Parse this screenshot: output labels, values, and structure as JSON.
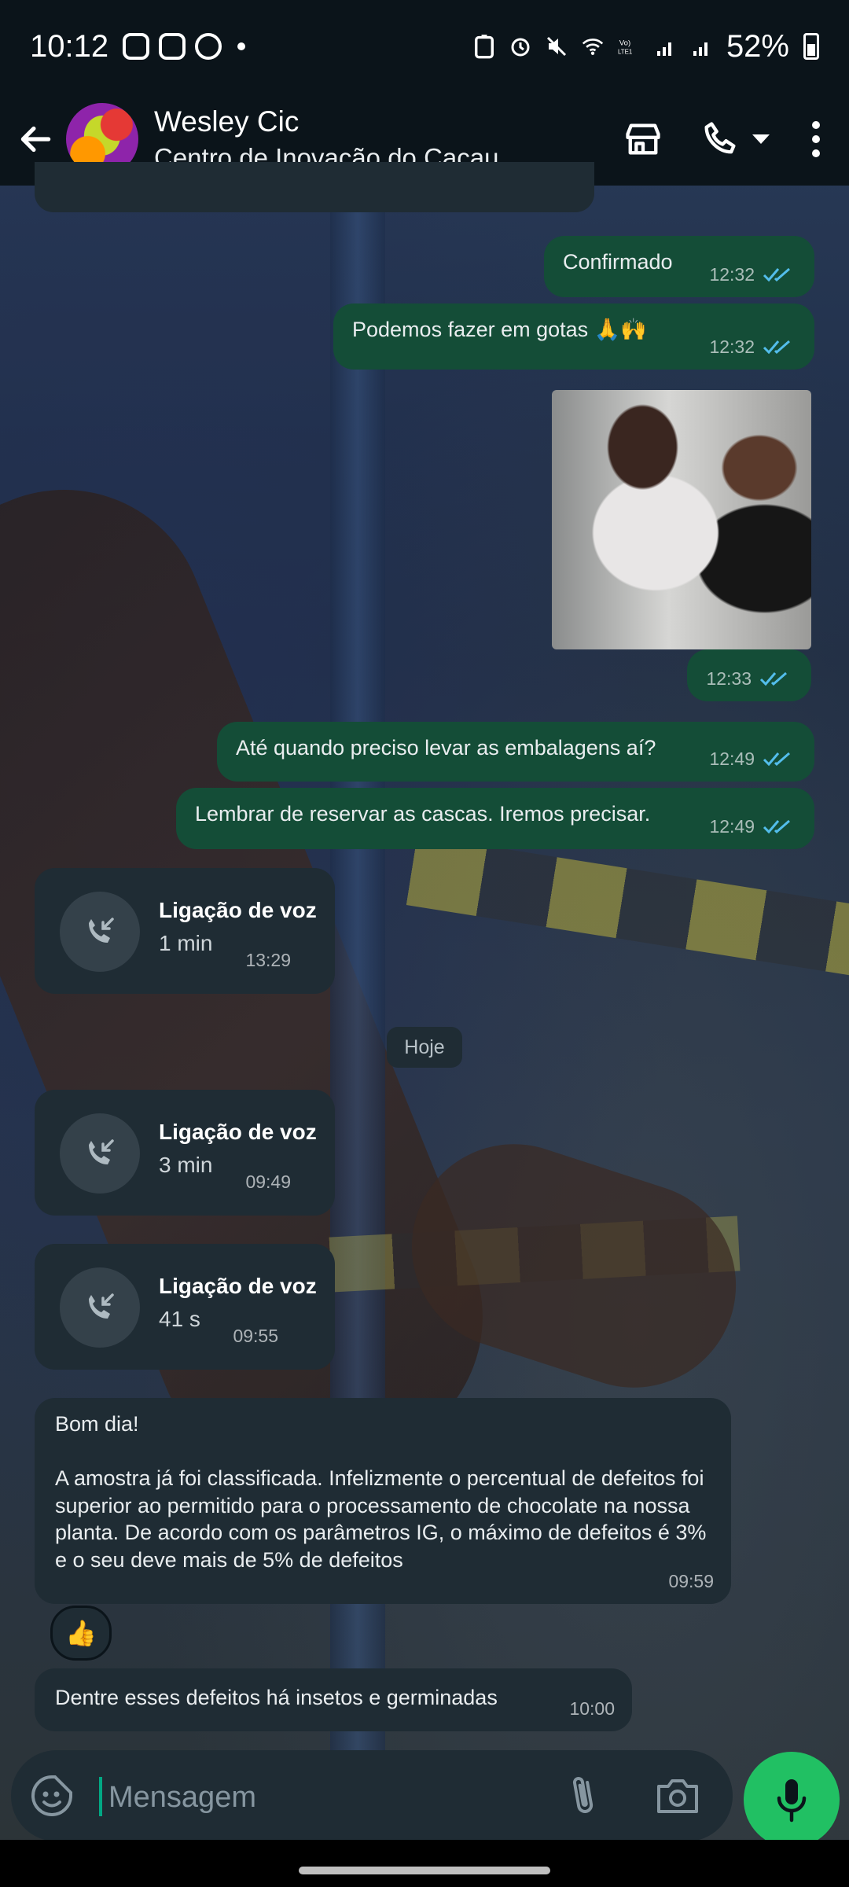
{
  "status_bar": {
    "time": "10:12",
    "battery": "52%"
  },
  "header": {
    "contact_name": "Wesley Cic",
    "subtitle": "Centro de Inovação do Cacau"
  },
  "messages": {
    "m1": {
      "text": "Confirmado",
      "time": "12:32"
    },
    "m2": {
      "text": "Podemos fazer em gotas 🙏🙌",
      "time": "12:32"
    },
    "m3": {
      "time": "12:33"
    },
    "m4": {
      "text": "Até quando preciso levar as embalagens aí?",
      "time": "12:49"
    },
    "m5": {
      "text": "Lembrar de reservar as cascas. Iremos precisar.",
      "time": "12:49"
    },
    "call1": {
      "title": "Ligação de voz",
      "duration": "1 min",
      "time": "13:29"
    },
    "date_separator": "Hoje",
    "call2": {
      "title": "Ligação de voz",
      "duration": "3 min",
      "time": "09:49"
    },
    "call3": {
      "title": "Ligação de voz",
      "duration": "41 s",
      "time": "09:55"
    },
    "m6": {
      "text": "Bom dia!\n\nA amostra já foi classificada. Infelizmente o percentual de defeitos foi superior ao permitido para o processamento de chocolate na nossa planta. De acordo com os parâmetros IG, o máximo de defeitos é 3% e o seu deve mais de 5% de defeitos",
      "time": "09:59",
      "reaction": "👍"
    },
    "m7": {
      "text": "Dentre esses defeitos há insetos e germinadas",
      "time": "10:00"
    }
  },
  "input": {
    "placeholder": "Mensagem"
  },
  "colors": {
    "outgoing_bubble": "#144d37",
    "incoming_bubble": "#1f2c34",
    "accent": "#21c063",
    "read_ticks": "#53bdeb"
  }
}
